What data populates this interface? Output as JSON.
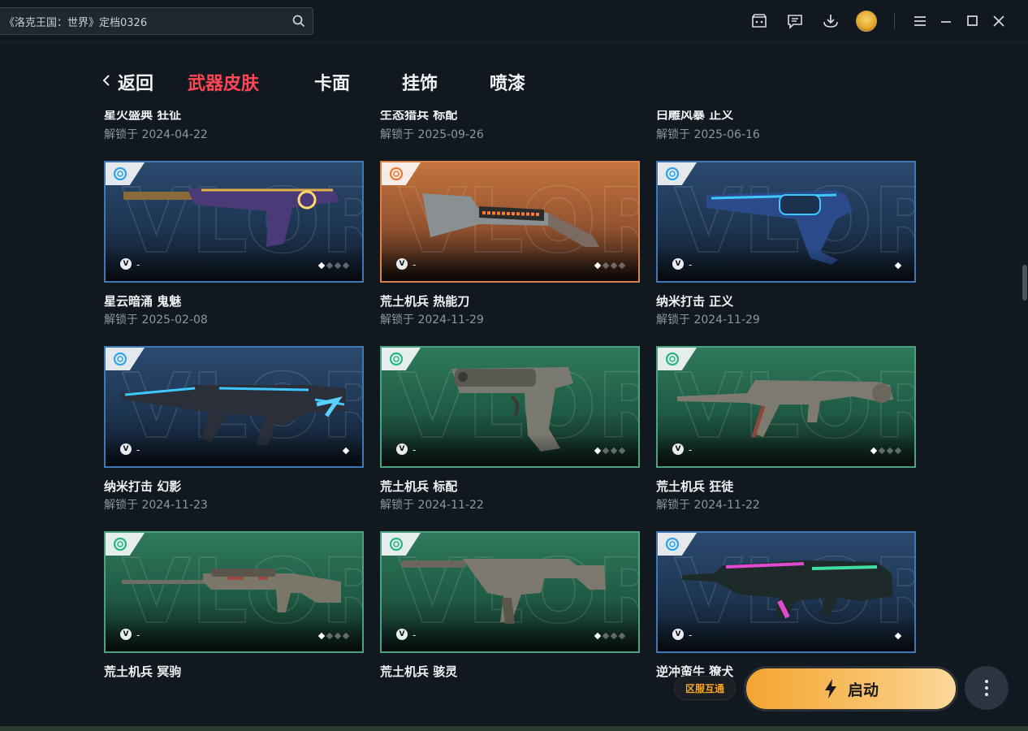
{
  "titlebar": {
    "search_value": "《洛克王国：世界》定档0326"
  },
  "nav": {
    "back": "返回",
    "tabs": [
      "武器皮肤",
      "卡面",
      "挂饰",
      "喷漆"
    ],
    "active_tab": "武器皮肤"
  },
  "top_partial_rows": [
    {
      "name": "星火盛典 狂征",
      "date": "解锁于 2024-04-22"
    },
    {
      "name": "生态猎兵 标配",
      "date": "解锁于 2025-09-26"
    },
    {
      "name": "白雕风暴 正义",
      "date": "解锁于 2025-06-16"
    }
  ],
  "cards": [
    {
      "name": "星云暗涌 鬼魅",
      "date": "解锁于 2025-02-08",
      "tier_color": "#2ea6e6",
      "theme": "blue",
      "variant_dash": "-",
      "dots_total": 4,
      "dots_on": 1
    },
    {
      "name": "荒土机兵 热能刀",
      "date": "解锁于 2024-11-29",
      "tier_color": "#e87a3a",
      "theme": "orange",
      "variant_dash": "-",
      "dots_total": 4,
      "dots_on": 1
    },
    {
      "name": "纳米打击 正义",
      "date": "解锁于 2024-11-29",
      "tier_color": "#2ea6e6",
      "theme": "blue",
      "variant_dash": "-",
      "dots_total": 1,
      "dots_on": 1
    },
    {
      "name": "纳米打击 幻影",
      "date": "解锁于 2024-11-23",
      "tier_color": "#2ea6e6",
      "theme": "blue",
      "variant_dash": "-",
      "dots_total": 1,
      "dots_on": 1
    },
    {
      "name": "荒土机兵 标配",
      "date": "解锁于 2024-11-22",
      "tier_color": "#2bb38a",
      "theme": "green",
      "variant_dash": "-",
      "dots_total": 4,
      "dots_on": 1
    },
    {
      "name": "荒土机兵 狂徒",
      "date": "解锁于 2024-11-22",
      "tier_color": "#2bb38a",
      "theme": "green",
      "variant_dash": "-",
      "dots_total": 4,
      "dots_on": 1
    },
    {
      "name": "荒土机兵 冥驹",
      "date": "",
      "tier_color": "#2bb38a",
      "theme": "green",
      "variant_dash": "-",
      "dots_total": 4,
      "dots_on": 1
    },
    {
      "name": "荒土机兵 骇灵",
      "date": "",
      "tier_color": "#2bb38a",
      "theme": "green",
      "variant_dash": "-",
      "dots_total": 4,
      "dots_on": 1
    },
    {
      "name": "逆冲蛮牛 獠犬",
      "date": "",
      "tier_color": "#2ea6e6",
      "theme": "blue",
      "variant_dash": "-",
      "dots_total": 1,
      "dots_on": 1
    }
  ],
  "bottom": {
    "region_label": "区服互通",
    "launch_label": "启动"
  },
  "colors": {
    "accent_red": "#ff4655",
    "launch_orange": "#f5a431"
  },
  "icons": [
    "search-icon",
    "store-icon",
    "message-icon",
    "download-icon",
    "avatar",
    "menu-icon",
    "minimize-icon",
    "maximize-icon",
    "close-icon",
    "back-chevron-icon",
    "lightning-icon",
    "more-vertical-icon"
  ]
}
